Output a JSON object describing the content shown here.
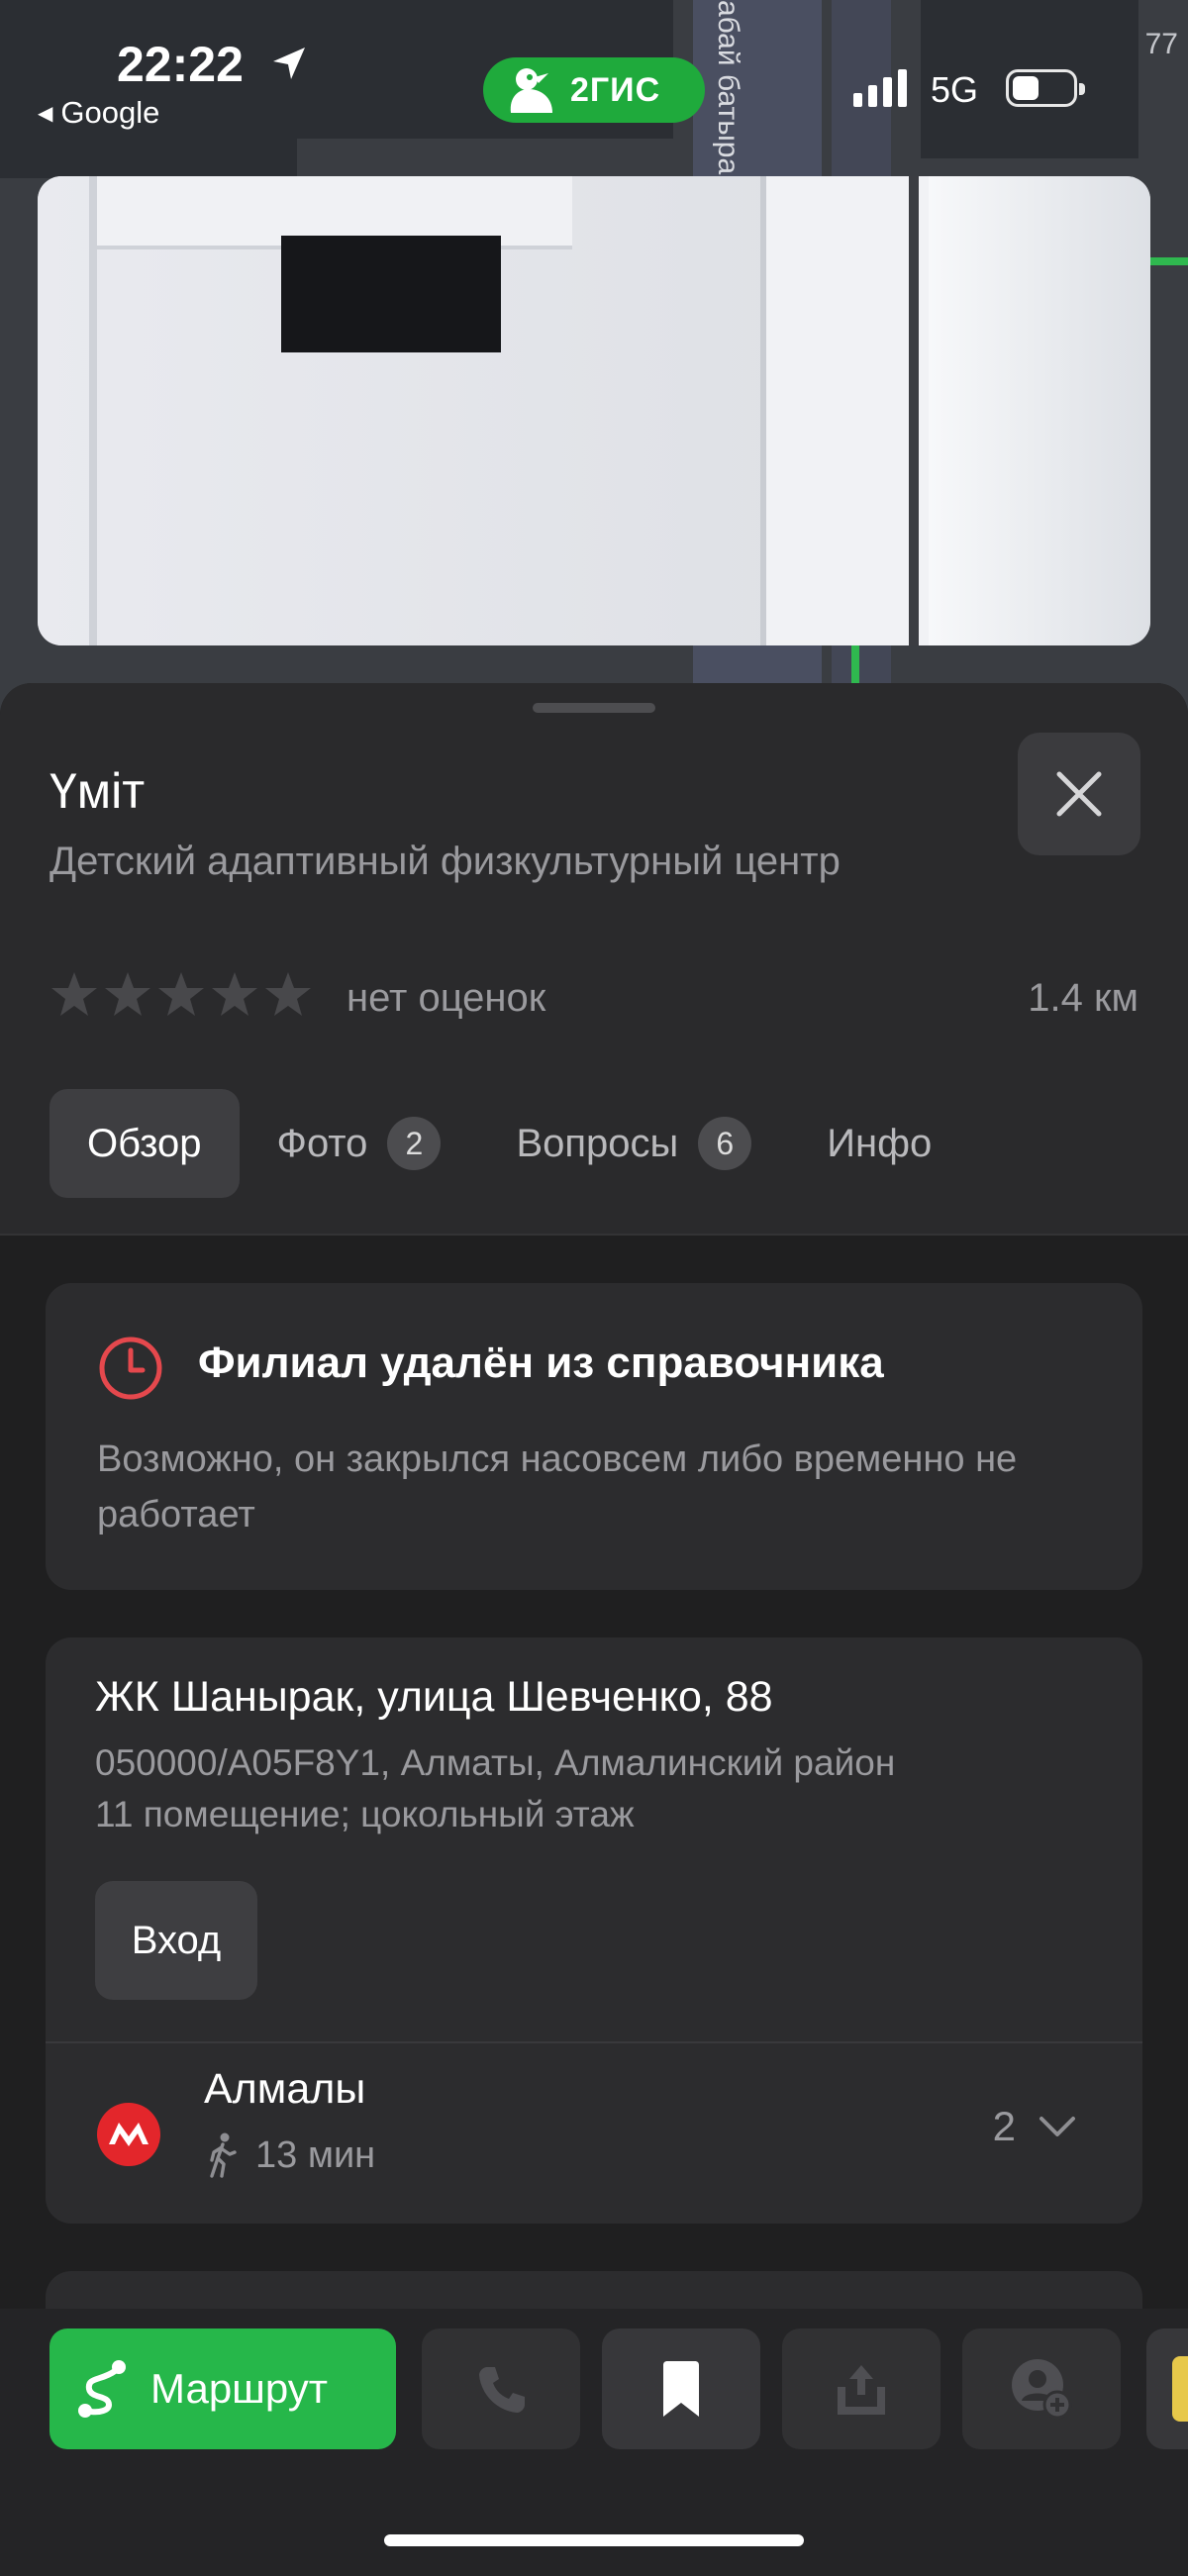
{
  "status_bar": {
    "time": "22:22",
    "back_app": "Google",
    "app_badge": "2ГИС",
    "network": "5G"
  },
  "map": {
    "street_label": "абай батыра",
    "corner_number": "77"
  },
  "place": {
    "name": "Үміт",
    "category": "Детский адаптивный физкультурный центр",
    "rating_stars": 0,
    "rating_text": "нет оценок",
    "distance": "1.4 км"
  },
  "tabs": [
    {
      "label": "Обзор",
      "active": true
    },
    {
      "label": "Фото",
      "count": "2"
    },
    {
      "label": "Вопросы",
      "count": "6"
    },
    {
      "label": "Инфо"
    }
  ],
  "notice": {
    "title": "Филиал удалён из справочника",
    "text": "Возможно, он закрылся насовсем либо временно не работает"
  },
  "address": {
    "main": "ЖК Шанырак, улица Шевченко, 88",
    "line1": "050000/A05F8Y1, Алматы, Алмалинский район",
    "line2": "11 помещение; цокольный этаж",
    "entrance_button": "Вход"
  },
  "metro": {
    "station": "Алмалы",
    "walk_time": "13 мин",
    "count": "2"
  },
  "actions": {
    "route": "Маршрут",
    "icons": [
      "phone-icon",
      "bookmark-icon",
      "share-icon",
      "add-contact-icon"
    ]
  },
  "colors": {
    "accent_green": "#26b74a",
    "metro_red": "#e3262b",
    "warning_red": "#e5484d",
    "sheet_bg": "#2a2a2c"
  }
}
